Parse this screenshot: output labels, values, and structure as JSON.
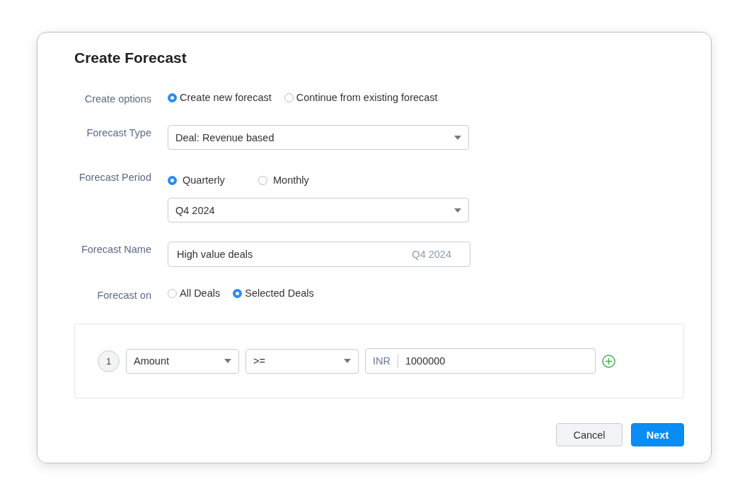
{
  "dialog": {
    "title": "Create Forecast"
  },
  "fields": [
    {
      "kind": "radios",
      "label": "Create options",
      "options": [
        {
          "label": "Create new forecast",
          "selected": true
        },
        {
          "label": "Continue from existing forecast",
          "selected": false
        }
      ]
    },
    {
      "kind": "select",
      "label": "Forecast Type",
      "value": "Deal: Revenue based"
    },
    {
      "kind": "period",
      "label": "Forecast Period",
      "options": [
        {
          "label": "Quarterly",
          "selected": true
        },
        {
          "label": "Monthly",
          "selected": false
        }
      ],
      "value": "Q4 2024"
    },
    {
      "kind": "text",
      "label": "Forecast Name",
      "value": "High value deals",
      "suffix": "Q4 2024"
    },
    {
      "kind": "radios",
      "label": "Forecast on",
      "options": [
        {
          "label": "All Deals",
          "selected": false
        },
        {
          "label": "Selected Deals",
          "selected": true
        }
      ]
    }
  ],
  "criteria": [
    {
      "number": "1",
      "field": "Amount",
      "operator": ">=",
      "currency": "INR",
      "value": "1000000"
    }
  ],
  "buttons": [
    {
      "label": "Cancel",
      "kind": "secondary"
    },
    {
      "label": "Next",
      "kind": "primary"
    }
  ]
}
